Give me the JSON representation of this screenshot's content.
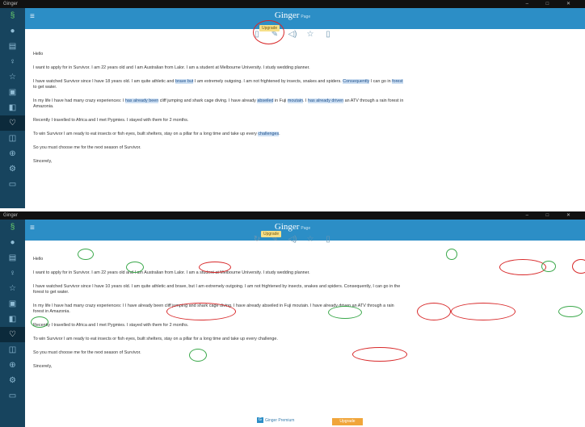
{
  "app_title": "Ginger",
  "window_controls": "–  □  ✕",
  "brand": {
    "name": "Ginger",
    "tag": "Page"
  },
  "upgrade_tooltip": "Upgrade",
  "sidebar_icons": [
    "ginger-logo-icon",
    "globe-icon",
    "document-icon",
    "bulb-icon",
    "star-icon",
    "notes-icon",
    "translate-icon",
    "heart-icon",
    "book-icon",
    "plus-circle-icon",
    "gear-icon",
    "chat-icon"
  ],
  "toolbar_icons": [
    "document-icon",
    "pencil-icon",
    "speaker-icon",
    "star-icon",
    "clipboard-icon"
  ],
  "document": {
    "greeting": "Hello",
    "p1": "I want to apply for in Survivor. I am 22 years old and I am Australian from Lalor. I am a student at Melbourne University. I study wedding planner.",
    "p2a": "I have watched Survivor since I have 18 years old. I am quite athletic and ",
    "p2_hl1": "brave but",
    "p2b": " I am extremely outgoing. I am not frightened by insects, snakes and spiders. ",
    "p2_hl2": "Consequently",
    "p2c": " I can go in ",
    "p2_hl3": "forest",
    "p2d": "to get water.",
    "p3a": "In my life I have had many crazy experiences: I ",
    "p3_hl1": "has already been",
    "p3b": " cliff jumping and shark cage diving. I have already ",
    "p3_hl2": "abseiled",
    "p3c": " in Fuji ",
    "p3_hl3": "moutain",
    "p3d": ". I ",
    "p3_hl4": "has already driven",
    "p3e": " an ATV through a rain forest in",
    "p3f": "Amazonia.",
    "p4": "Recently I travelled to Africa and I met Pygmies. I stayed with them for 2 months.",
    "p5a": "To win Survivor I am ready to eat insects or fish eyes, built shelters, stay on a pillar for a long time and take up every ",
    "p5_hl": "challenges",
    "p5b": ".",
    "p6": "So you must choose me for the next season of Survivor.",
    "closing": "Sincerely,"
  },
  "document2": {
    "p2_prefix": "I have watched Survivor since ",
    "p2_since": "I have",
    "p2_after": " 10 years old. I am quite athletic and ",
    "p2_hl1": "brave, but",
    "p2b": " I am extremely outgoing. I am not frightened by insects, snakes and spiders. ",
    "p2_hl2": "Consequently,",
    "p2c": " I can go in the",
    "p2d": "forest to get water.",
    "p3_hl1": "I have already been",
    "p3c": " in Fuji ",
    "p3_hl2": "moutain",
    "p3d": ". I ",
    "p3_hl3": "have already driven",
    "p3e": " an ATV through a rain",
    "p3f": "forest in Amazonia.",
    "p5a": "To win Survivor I am ready to eat insects or fish eyes, ",
    "p5_built": "built",
    "p5_mid": " shelters, stay on a pillar for a long time and take up ",
    "p5_hl": "every challenge",
    "p5b": "."
  },
  "footer": {
    "premium": "Ginger Premium",
    "upgrade": "Upgrade"
  }
}
